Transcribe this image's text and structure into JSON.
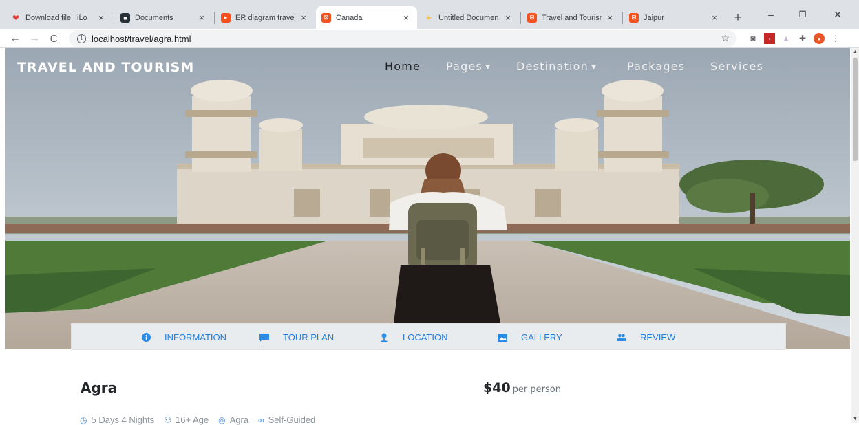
{
  "browser": {
    "tabs": [
      {
        "title": "Download file | iLo",
        "favicon_color": "#e53935",
        "active": false
      },
      {
        "title": "Documents",
        "favicon_color": "#263238",
        "active": false
      },
      {
        "title": "ER diagram travel",
        "favicon_color": "#f4511e",
        "active": false
      },
      {
        "title": "Canada",
        "favicon_color": "#f4511e",
        "active": true
      },
      {
        "title": "Untitled Documen",
        "favicon_color": "#fbc02d",
        "active": false
      },
      {
        "title": "Travel and Tourism",
        "favicon_color": "#f4511e",
        "active": false
      },
      {
        "title": "Jaipur",
        "favicon_color": "#f4511e",
        "active": false
      }
    ],
    "tab_close_glyph": "×",
    "new_tab_glyph": "+",
    "window_controls": {
      "minimize": "–",
      "restore": "❐",
      "close": "✕"
    },
    "url": "localhost/travel/agra.html",
    "bookmark_icon": "star-icon"
  },
  "site": {
    "brand": "TRAVEL AND TOURISM",
    "nav": [
      {
        "label": "Home",
        "dropdown": false
      },
      {
        "label": "Pages",
        "dropdown": true
      },
      {
        "label": "Destination",
        "dropdown": true
      },
      {
        "label": "Packages",
        "dropdown": false
      },
      {
        "label": "Services",
        "dropdown": false
      }
    ],
    "subnav": [
      {
        "label": "INFORMATION",
        "icon": "info-icon"
      },
      {
        "label": "TOUR PLAN",
        "icon": "chat-icon"
      },
      {
        "label": "LOCATION",
        "icon": "map-pin-icon"
      },
      {
        "label": "GALLERY",
        "icon": "image-icon"
      },
      {
        "label": "REVIEW",
        "icon": "users-icon"
      }
    ],
    "accent_color": "#1e7fe0"
  },
  "tour": {
    "title": "Agra",
    "price": "$40",
    "price_unit": "per person",
    "meta": [
      {
        "text": "5 Days 4 Nights",
        "icon": "clock-icon"
      },
      {
        "text": "16+ Age",
        "icon": "users-icon"
      },
      {
        "text": "Agra",
        "icon": "map-pin-icon"
      },
      {
        "text": "Self-Guided",
        "icon": "binoculars-icon"
      }
    ]
  }
}
